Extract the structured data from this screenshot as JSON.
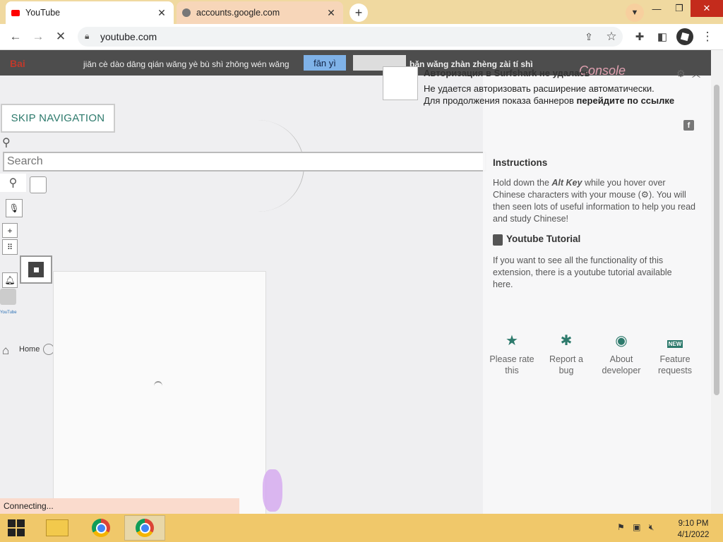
{
  "browser": {
    "tabs": [
      {
        "title": "YouTube",
        "icon": "youtube-favicon"
      },
      {
        "title": "accounts.google.com",
        "icon": "globe-favicon"
      }
    ],
    "new_tab": "+",
    "url": "youtube.com"
  },
  "baidu_bar": {
    "logo": "Bai",
    "pinyin": "jiǎn cè dào dāng qián wǎng yè bù shì zhōng wén wǎng",
    "translate_button": "fān yì",
    "pinyin_right": "bǎn wǎng zhàn zhèng zài tí shì",
    "console_logo": "Console"
  },
  "notice": {
    "title": "Авторизация в Surfshark не удалась",
    "line1": "Не удается авторизовать расширение автоматически.",
    "line2_prefix": "Для продолжения показа баннеров ",
    "line2_link": "перейдите по ссылке"
  },
  "youtube": {
    "skip_navigation": "SKIP NAVIGATION",
    "search_placeholder": "Search",
    "home_label": "Home",
    "yt_mini_logo": "YouTube"
  },
  "extension": {
    "instructions_title": "Instructions",
    "instructions_before": "Hold down the ",
    "instructions_key": "Alt Key",
    "instructions_after": " while you hover over Chinese characters with your mouse (⚙). You will then seen lots of useful information to help you read and study Chinese!",
    "tutorial_title": "Youtube Tutorial",
    "tutorial_body": "If you want to see all the functionality of this extension, there is a youtube tutorial available here.",
    "actions": [
      {
        "label": "Please rate this",
        "icon": "star-icon"
      },
      {
        "label": "Report a bug",
        "icon": "bug-icon"
      },
      {
        "label": "About developer",
        "icon": "panda-icon"
      },
      {
        "label": "Feature requests",
        "icon": "new-icon"
      }
    ]
  },
  "status_bar": {
    "text": "Connecting..."
  },
  "taskbar": {
    "time": "9:10 PM",
    "date": "4/1/2022"
  }
}
